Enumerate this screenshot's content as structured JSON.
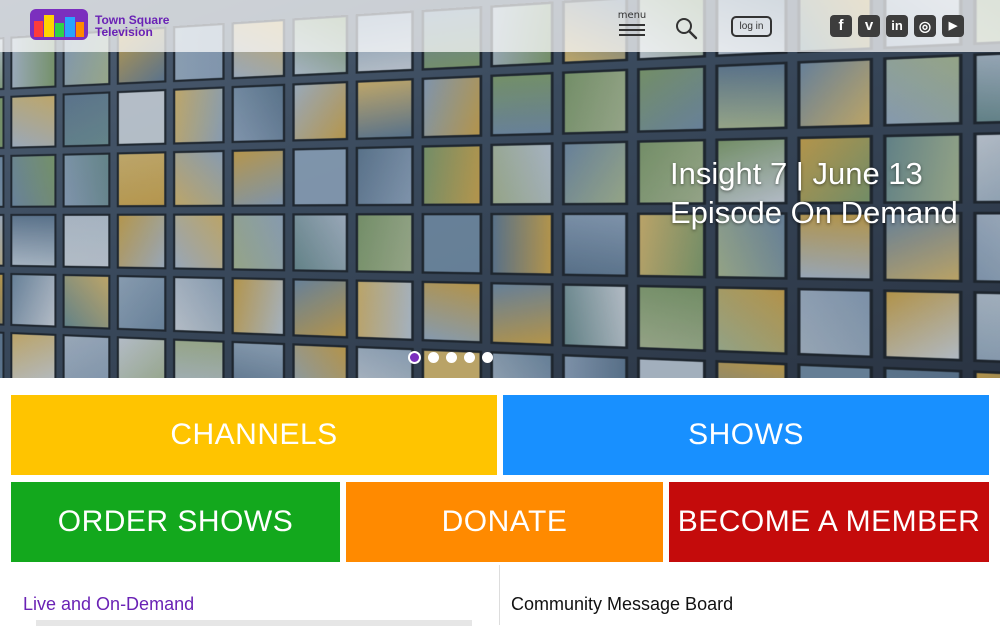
{
  "header": {
    "brand_line1": "Town Square",
    "brand_line2": "Television",
    "menu_label": "menu",
    "login_label": "log in",
    "social": [
      {
        "icon": "facebook-icon",
        "glyph": "f"
      },
      {
        "icon": "vimeo-icon",
        "glyph": "v"
      },
      {
        "icon": "linkedin-icon",
        "glyph": "in"
      },
      {
        "icon": "instagram-icon",
        "glyph": "◎"
      },
      {
        "icon": "youtube-icon",
        "glyph": "▶"
      }
    ]
  },
  "hero": {
    "headline_line1": "Insight 7 | June 13",
    "headline_line2": "Episode On Demand",
    "slide_count": 5,
    "active_slide": 1
  },
  "tiles": [
    {
      "label": "CHANNELS",
      "color": "#ffc400"
    },
    {
      "label": "SHOWS",
      "color": "#1890ff"
    },
    {
      "label": "ORDER SHOWS",
      "color": "#13a81d"
    },
    {
      "label": "DONATE",
      "color": "#ff8a00"
    },
    {
      "label": "BECOME A MEMBER",
      "color": "#c40b0b"
    }
  ],
  "sections": {
    "live_title": "Live and On-Demand",
    "board_title": "Community Message Board"
  },
  "colors": {
    "brand_purple": "#6a22b5"
  }
}
